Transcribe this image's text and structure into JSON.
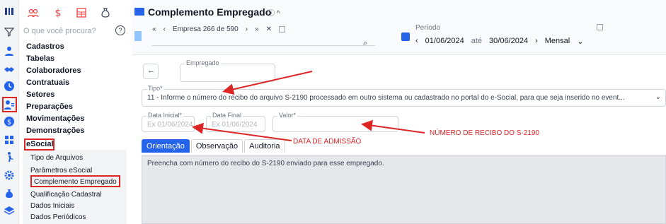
{
  "window": {
    "title": "Complemento Empregado"
  },
  "search": {
    "placeholder": "O que você procura?"
  },
  "nav": {
    "items": [
      "Cadastros",
      "Tabelas",
      "Colaboradores",
      "Contratuais",
      "Setores",
      "Preparações",
      "Movimentações",
      "Demonstrações",
      "eSocial"
    ],
    "sub_items": [
      "Tipo de Arquivos",
      "Parâmetros eSocial",
      "Complemento Empregado",
      "Qualificação Cadastral",
      "Dados Iniciais",
      "Dados Periódicos"
    ]
  },
  "header": {
    "pager_text": "Empresa 266 de 590",
    "periodo_label": "Período",
    "periodo_start": "01/06/2024",
    "periodo_sep": "até",
    "periodo_end": "30/06/2024",
    "periodo_type": "Mensal"
  },
  "form": {
    "empregado_label": "Empregado",
    "tipo_label": "Tipo*",
    "tipo_value": "11 - Informe o número do recibo do arquivo S-2190 processado em outro sistema ou cadastrado no portal do e-Social, para que seja inserido no event...",
    "data_inicial_label": "Data Inicial*",
    "data_inicial_placeholder": "Ex 01/06/2024",
    "data_final_label": "Data Final",
    "data_final_placeholder": "Ex 01/06/2024",
    "valor_label": "Valor*"
  },
  "tabs": [
    "Orientação",
    "Observação",
    "Auditoria"
  ],
  "orientacao_text": "Preencha com número do recibo do S-2190 enviado para esse empregado.",
  "annotations": {
    "admissao": "DATA DE ADMISSÃO",
    "recibo": "NÚMERO DE RECIBO DO S-2190"
  },
  "colors": {
    "accent": "#2563eb",
    "annotation": "#dc2626",
    "brand_icon": "#1e3a8a"
  }
}
